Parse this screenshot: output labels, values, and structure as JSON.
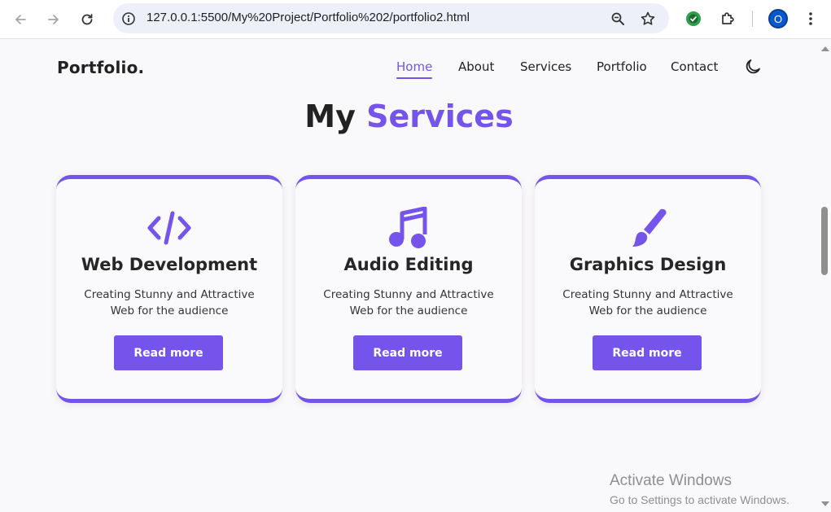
{
  "browser": {
    "url": "127.0.0.1:5500/My%20Project/Portfolio%202/portfolio2.html",
    "profile_initial": "O"
  },
  "nav": {
    "logo": "Portfolio.",
    "items": [
      {
        "label": "Home",
        "active": true
      },
      {
        "label": "About",
        "active": false
      },
      {
        "label": "Services",
        "active": false
      },
      {
        "label": "Portfolio",
        "active": false
      },
      {
        "label": "Contact",
        "active": false
      }
    ],
    "theme_icon": "moon-icon"
  },
  "section": {
    "title_plain": "My",
    "title_accent": "Services"
  },
  "services": [
    {
      "icon": "code-icon",
      "title": "Web Development",
      "desc": "Creating Stunny and Attractive Web for the audience",
      "button": "Read more"
    },
    {
      "icon": "music-note-icon",
      "title": "Audio Editing",
      "desc": "Creating Stunny and Attractive Web for the audience",
      "button": "Read more"
    },
    {
      "icon": "paintbrush-icon",
      "title": "Graphics Design",
      "desc": "Creating Stunny and Attractive Web for the audience",
      "button": "Read more"
    }
  ],
  "watermark": {
    "title": "Activate Windows",
    "subtitle": "Go to Settings to activate Windows."
  },
  "colors": {
    "accent": "#7454ea",
    "text": "#222222",
    "background": "#f9f8fa"
  }
}
